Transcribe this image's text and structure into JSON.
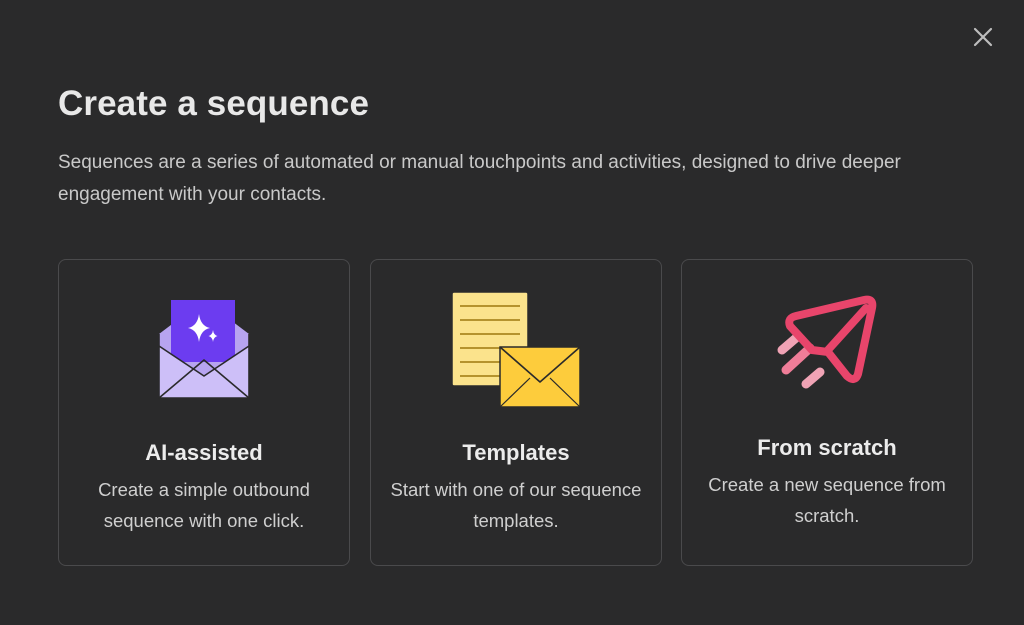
{
  "dialog": {
    "title": "Create a sequence",
    "description": "Sequences are a series of automated or manual touchpoints and activities, designed to drive deeper engagement with your contacts.",
    "close_icon": "close-icon"
  },
  "options": [
    {
      "id": "ai-assisted",
      "title": "AI-assisted",
      "description": "Create a simple outbound sequence with one click.",
      "icon": "ai-envelope-icon"
    },
    {
      "id": "templates",
      "title": "Templates",
      "description": "Start with one of our sequence templates.",
      "icon": "template-document-envelope-icon"
    },
    {
      "id": "from-scratch",
      "title": "From scratch",
      "description": "Create a new sequence from scratch.",
      "icon": "paper-plane-icon"
    }
  ],
  "colors": {
    "background": "#2a2a2b",
    "card_border": "#4a4a4c",
    "ai_purple": "#6c3cf0",
    "envelope_lavender": "#c6b6f5",
    "doc_yellow": "#fbe38c",
    "envelope_yellow": "#fdcc3c",
    "plane_pink": "#e8456b"
  }
}
